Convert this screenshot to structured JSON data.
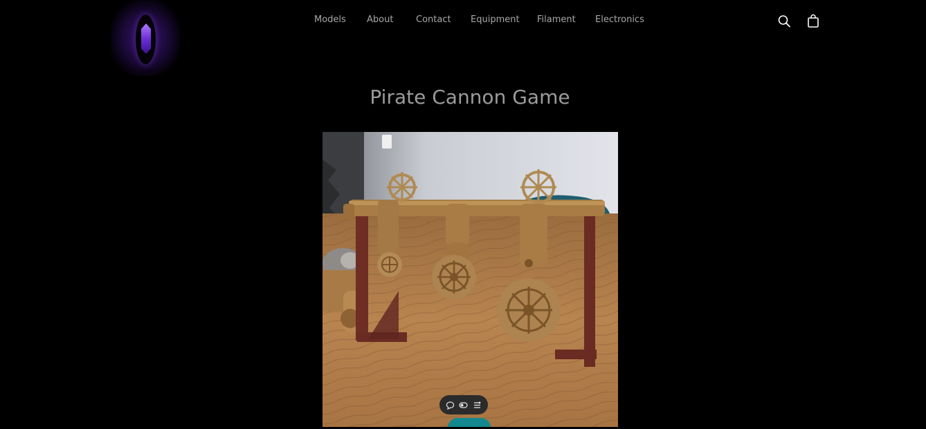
{
  "header": {
    "logo_name": "crystal-logo",
    "nav": [
      {
        "label": "Models"
      },
      {
        "label": "About"
      },
      {
        "label": "Contact"
      },
      {
        "label": "Equipment"
      },
      {
        "label": "Filament"
      },
      {
        "label": "Electronics"
      }
    ],
    "icons": {
      "search": "search-icon",
      "cart": "shopping-bag-icon"
    }
  },
  "main": {
    "title": "Pirate Cannon Game",
    "media": {
      "toolbar_icons": [
        "comment-icon",
        "toggle-icon",
        "menu-icon"
      ]
    }
  },
  "colors": {
    "background": "#000000",
    "nav_text": "#a9a9a9",
    "title_text": "#9c9c9c",
    "accent_teal": "#13888e",
    "logo_purple": "#6d2fd6"
  }
}
